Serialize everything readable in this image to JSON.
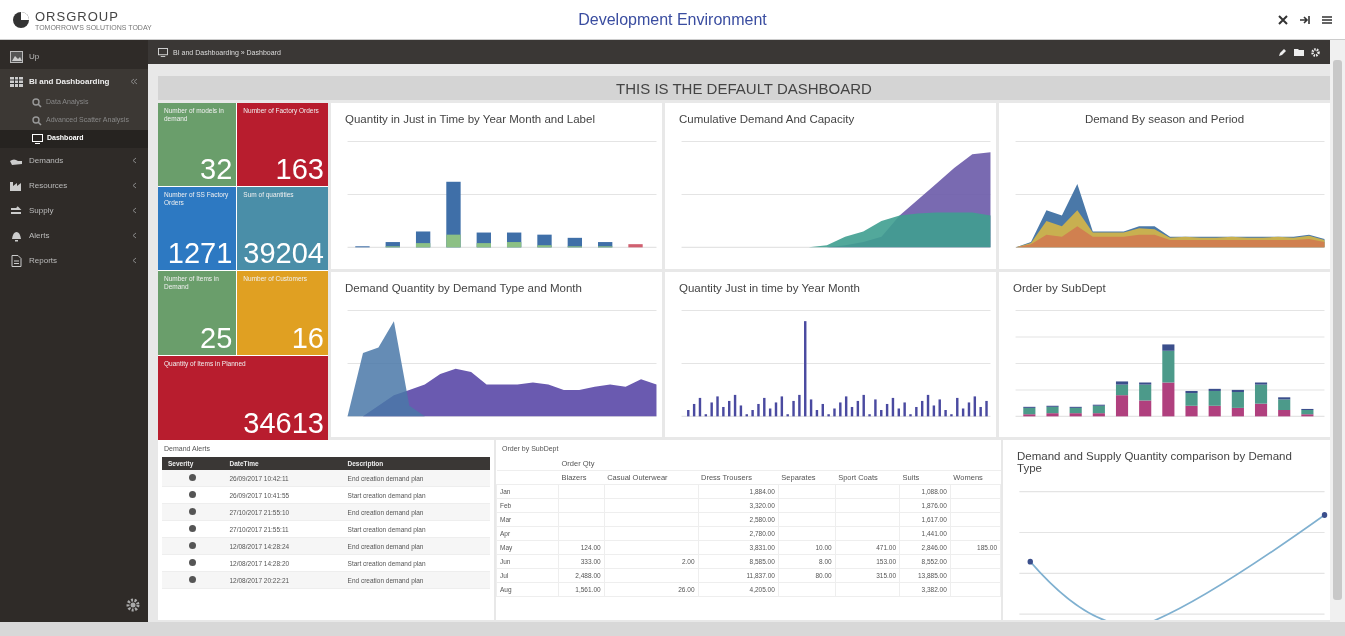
{
  "header": {
    "logo_text": "ORSGROUP",
    "logo_tagline": "TOMORROW'S SOLUTIONS TODAY",
    "title": "Development Environment"
  },
  "sidebar": {
    "items": [
      {
        "label": "Up"
      },
      {
        "label": "BI and Dashboarding",
        "expanded": true,
        "children": [
          {
            "label": "Data Analysis",
            "selected": false
          },
          {
            "label": "Advanced Scatter Analysis",
            "selected": false
          },
          {
            "label": "Dashboard",
            "selected": true
          }
        ]
      },
      {
        "label": "Demands",
        "expanded": false
      },
      {
        "label": "Resources",
        "expanded": false
      },
      {
        "label": "Supply",
        "expanded": false
      },
      {
        "label": "Alerts",
        "expanded": false
      },
      {
        "label": "Reports",
        "expanded": false
      }
    ]
  },
  "breadcrumb": "BI and Dashboarding » Dashboard",
  "banner": "THIS IS THE DEFAULT DASHBOARD",
  "tiles": [
    {
      "label": "Number of models in demand",
      "value": "32",
      "color": "#6a9e6b"
    },
    {
      "label": "Number of Factory Orders",
      "value": "163",
      "color": "#b81d2e"
    },
    {
      "label": "Number of SS Factory Orders",
      "value": "1271",
      "color": "#2d79c2"
    },
    {
      "label": "Sum of quantities",
      "value": "39204",
      "color": "#4a8ea8"
    },
    {
      "label": "Number of Items in Demand",
      "value": "25",
      "color": "#6a9e6b"
    },
    {
      "label": "Number of Customers",
      "value": "16",
      "color": "#e0a022"
    },
    {
      "label": "Quantity of Items in Planned",
      "value": "34613",
      "color": "#b81d2e"
    }
  ],
  "charts": [
    {
      "title": "Quantity in Just in Time by Year Month and Label",
      "kind": "bars"
    },
    {
      "title": "Cumulative Demand And Capacity",
      "kind": "cumulative"
    },
    {
      "title": "Demand By season and Period",
      "kind": "layers"
    },
    {
      "title": "Demand Quantity by Demand Type and Month",
      "kind": "areas"
    },
    {
      "title": "Quantity Just in time by Year Month",
      "kind": "thin-bars"
    },
    {
      "title": "Order by SubDept",
      "kind": "stacked"
    }
  ],
  "alerts": {
    "title": "Demand Alerts",
    "columns": [
      "Severity",
      "DateTime",
      "Description"
    ],
    "rows": [
      {
        "datetime": "26/09/2017 10:42:11",
        "description": "End creation demand plan"
      },
      {
        "datetime": "26/09/2017 10:41:55",
        "description": "Start creation demand plan"
      },
      {
        "datetime": "27/10/2017 21:55:10",
        "description": "End creation demand plan"
      },
      {
        "datetime": "27/10/2017 21:55:11",
        "description": "Start creation demand plan"
      },
      {
        "datetime": "12/08/2017 14:28:24",
        "description": "End creation demand plan"
      },
      {
        "datetime": "12/08/2017 14:28:20",
        "description": "Start creation demand plan"
      },
      {
        "datetime": "12/08/2017 20:22:21",
        "description": "End creation demand plan"
      }
    ]
  },
  "pivot": {
    "title": "Order by SubDept",
    "measure": "Order Qty",
    "columns": [
      "Blazers",
      "Casual Outerwear",
      "Dress Trousers",
      "Separates",
      "Sport Coats",
      "Suits",
      "Womens"
    ],
    "rows": [
      {
        "label": "Jan",
        "cells": [
          "",
          "",
          "1,884.00",
          "",
          "",
          "1,088.00",
          ""
        ]
      },
      {
        "label": "Feb",
        "cells": [
          "",
          "",
          "3,320.00",
          "",
          "",
          "1,876.00",
          ""
        ]
      },
      {
        "label": "Mar",
        "cells": [
          "",
          "",
          "2,580.00",
          "",
          "",
          "1,617.00",
          ""
        ]
      },
      {
        "label": "Apr",
        "cells": [
          "",
          "",
          "2,780.00",
          "",
          "",
          "1,441.00",
          ""
        ]
      },
      {
        "label": "May",
        "cells": [
          "124.00",
          "",
          "3,831.00",
          "10.00",
          "471.00",
          "2,846.00",
          "185.00"
        ]
      },
      {
        "label": "Jun",
        "cells": [
          "333.00",
          "2.00",
          "8,585.00",
          "8.00",
          "153.00",
          "8,552.00",
          ""
        ]
      },
      {
        "label": "Jul",
        "cells": [
          "2,488.00",
          "",
          "11,837.00",
          "80.00",
          "315.00",
          "13,885.00",
          ""
        ]
      },
      {
        "label": "Aug",
        "cells": [
          "1,561.00",
          "26.00",
          "4,205.00",
          "",
          "",
          "3,382.00",
          ""
        ]
      }
    ]
  },
  "comparison_chart": {
    "title": "Demand and Supply Quantity comparison by Demand Type",
    "kind": "curve"
  }
}
